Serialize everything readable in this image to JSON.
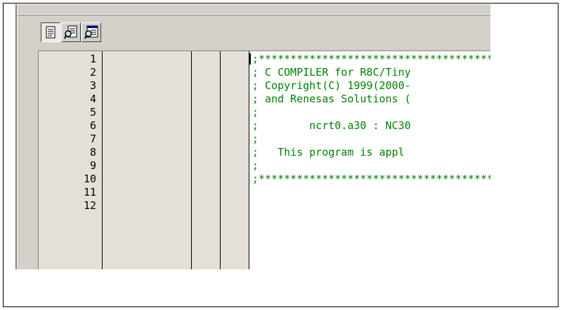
{
  "toolbar": {
    "buttons": [
      {
        "icon": "source-view-icon",
        "pressed": true
      },
      {
        "icon": "mixed-view-icon",
        "pressed": false
      },
      {
        "icon": "disassembly-view-icon",
        "pressed": false
      }
    ]
  },
  "editor": {
    "line_numbers": [
      "1",
      "2",
      "3",
      "4",
      "5",
      "6",
      "7",
      "8",
      "9",
      "10",
      "11",
      "12"
    ],
    "code_lines": [
      ";***************************************",
      "; C COMPILER for R8C/Tiny",
      "; Copyright(C) 1999(2000-",
      "; and Renesas Solutions (",
      ";",
      ";        ncrt0.a30 : NC30",
      ";",
      ";   This program is appl",
      ";",
      ";***************************************",
      "",
      ""
    ],
    "code_color": "#008000"
  }
}
